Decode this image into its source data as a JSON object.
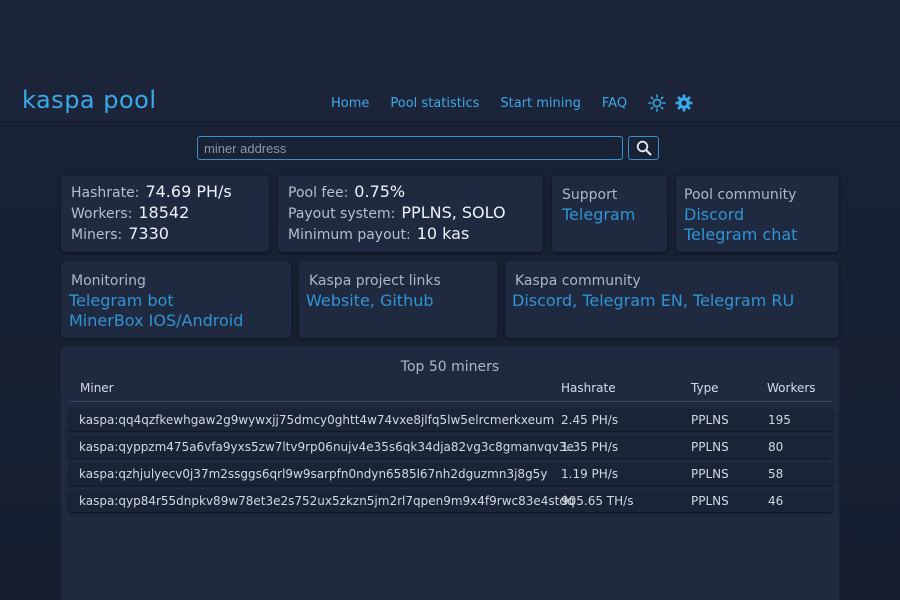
{
  "brand": "kaspa pool",
  "nav": {
    "items": [
      "Home",
      "Pool statistics",
      "Start mining",
      "FAQ"
    ],
    "theme_icon": "sun-icon",
    "settings_icon": "gear-icon"
  },
  "search": {
    "placeholder": "miner address",
    "button_icon": "search-icon"
  },
  "stats": {
    "hashrate_label": "Hashrate:",
    "hashrate_value": "74.69 PH/s",
    "workers_label": "Workers:",
    "workers_value": "18542",
    "miners_label": "Miners:",
    "miners_value": "7330"
  },
  "fees": {
    "fee_label": "Pool fee:",
    "fee_value": "0.75%",
    "payout_label": "Payout system:",
    "payout_value": "PPLNS, SOLO",
    "min_label": "Minimum payout:",
    "min_value": "10 kas"
  },
  "support": {
    "title": "Support",
    "links": [
      "Telegram"
    ]
  },
  "pool_community": {
    "title": "Pool community",
    "links": [
      "Discord",
      "Telegram chat"
    ]
  },
  "monitoring": {
    "title": "Monitoring",
    "links": [
      "Telegram bot",
      "MinerBox IOS/Android"
    ]
  },
  "project_links": {
    "title": "Kaspa project links",
    "links": [
      "Website, Github"
    ]
  },
  "kaspa_community": {
    "title": "Kaspa community",
    "links": [
      "Discord, Telegram EN, Telegram RU"
    ]
  },
  "top_miners": {
    "title": "Top 50 miners",
    "columns": [
      "Miner",
      "Hashrate",
      "Type",
      "Workers"
    ],
    "rows": [
      [
        "kaspa:qq4qzfkewhgaw2g9wywxjj75dmcy0ghtt4w74vxe8jlfq5lw5elrcmerkxeum",
        "2.45 PH/s",
        "PPLNS",
        "195"
      ],
      [
        "kaspa:qyppzm475a6vfa9yxs5zw7ltv9rp06nujv4e35s6qk34dja82vg3c8gmanvqv3e",
        "1.35 PH/s",
        "PPLNS",
        "80"
      ],
      [
        "kaspa:qzhjulyecv0j37m2ssggs6qrl9w9sarpfn0ndyn6585l67nh2dguzmn3j8g5y",
        "1.19 PH/s",
        "PPLNS",
        "58"
      ],
      [
        "kaspa:qyp84r55dnpkv89w78et3e2s752ux5zkzn5jm2rl7qpen9m9x4f9rwc83e4stdq",
        "905.65 TH/s",
        "PPLNS",
        "46"
      ]
    ]
  },
  "colors": {
    "accent": "#3aa9e8",
    "background": "#1a2236",
    "card": "#1f2940"
  }
}
